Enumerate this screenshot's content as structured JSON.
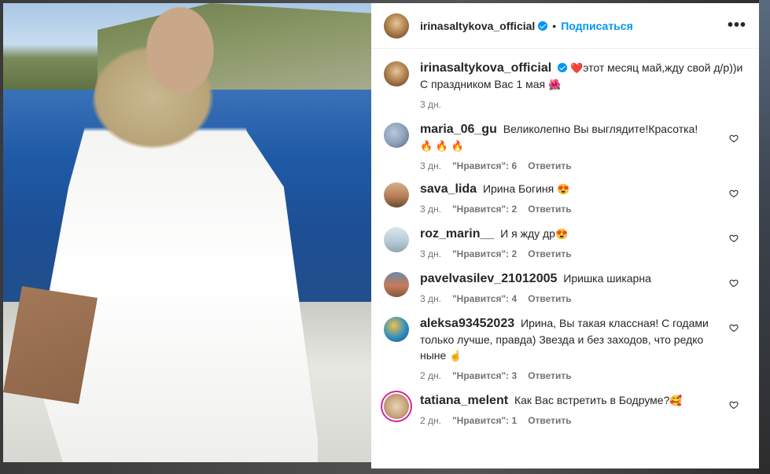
{
  "header": {
    "username": "irinasaltykova_official",
    "separator": "•",
    "follow_label": "Подписаться",
    "more_label": "•••"
  },
  "caption": {
    "username": "irinasaltykova_official",
    "heart": "❤️",
    "text": "этот месяц май,жду свой д/р))и С праздником Вас 1 мая",
    "emoji": "🌺",
    "time": "3 дн."
  },
  "comments": [
    {
      "username": "maria_06_gu",
      "text": "Великолепно Вы выглядите!Красотка!",
      "emoji": "🔥 🔥 🔥",
      "time": "3 дн.",
      "likes": "\"Нравится\": 6",
      "reply": "Ответить"
    },
    {
      "username": "sava_lida",
      "text": "Ирина Богиня",
      "emoji": "😍",
      "time": "3 дн.",
      "likes": "\"Нравится\": 2",
      "reply": "Ответить"
    },
    {
      "username": "roz_marin__",
      "text": "И я жду др",
      "emoji": "😍",
      "time": "3 дн.",
      "likes": "\"Нравится\": 2",
      "reply": "Ответить"
    },
    {
      "username": "pavelvasilev_21012005",
      "text": "Иришка шикарна",
      "emoji": "",
      "time": "3 дн.",
      "likes": "\"Нравится\": 4",
      "reply": "Ответить"
    },
    {
      "username": "aleksa93452023",
      "text": "Ирина, Вы такая классная! С годами только лучше, правда) Звезда и без заходов, что редко ныне",
      "emoji": "☝️",
      "time": "2 дн.",
      "likes": "\"Нравится\": 3",
      "reply": "Ответить"
    },
    {
      "username": "tatiana_melent",
      "text": "Как Вас встретить в Бодруме?",
      "emoji": "🥰",
      "time": "2 дн.",
      "likes": "\"Нравится\": 1",
      "reply": "Ответить"
    }
  ],
  "icons": {
    "verified": "verified-badge-icon",
    "heart": "heart-outline-icon",
    "more": "more-options-icon"
  }
}
